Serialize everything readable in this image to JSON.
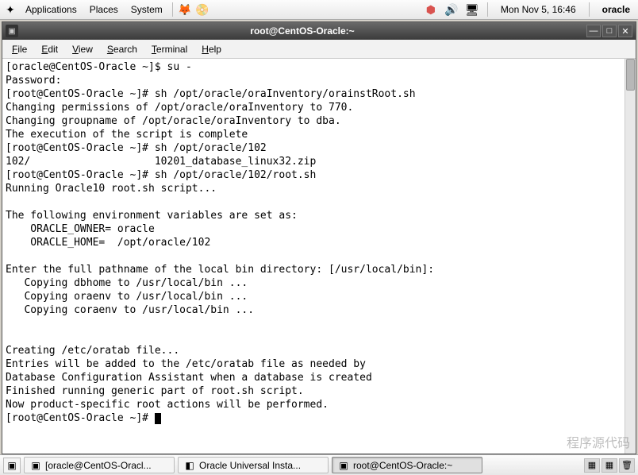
{
  "panel": {
    "applications": "Applications",
    "places": "Places",
    "system": "System",
    "clock": "Mon Nov  5, 16:46",
    "user": "oracle"
  },
  "window": {
    "title": "root@CentOS-Oracle:~"
  },
  "menus": {
    "file": "File",
    "edit": "Edit",
    "view": "View",
    "search": "Search",
    "terminal": "Terminal",
    "help": "Help"
  },
  "terminal": {
    "lines": [
      "[oracle@CentOS-Oracle ~]$ su -",
      "Password:",
      "[root@CentOS-Oracle ~]# sh /opt/oracle/oraInventory/orainstRoot.sh",
      "Changing permissions of /opt/oracle/oraInventory to 770.",
      "Changing groupname of /opt/oracle/oraInventory to dba.",
      "The execution of the script is complete",
      "[root@CentOS-Oracle ~]# sh /opt/oracle/102",
      "102/                    10201_database_linux32.zip",
      "[root@CentOS-Oracle ~]# sh /opt/oracle/102/root.sh",
      "Running Oracle10 root.sh script...",
      "",
      "The following environment variables are set as:",
      "    ORACLE_OWNER= oracle",
      "    ORACLE_HOME=  /opt/oracle/102",
      "",
      "Enter the full pathname of the local bin directory: [/usr/local/bin]:",
      "   Copying dbhome to /usr/local/bin ...",
      "   Copying oraenv to /usr/local/bin ...",
      "   Copying coraenv to /usr/local/bin ...",
      "",
      "",
      "Creating /etc/oratab file...",
      "Entries will be added to the /etc/oratab file as needed by",
      "Database Configuration Assistant when a database is created",
      "Finished running generic part of root.sh script.",
      "Now product-specific root actions will be performed.",
      "[root@CentOS-Oracle ~]# "
    ]
  },
  "taskbar": {
    "task1": "[oracle@CentOS-Oracl...",
    "task2": "Oracle Universal Insta...",
    "task3": "root@CentOS-Oracle:~"
  },
  "watermark": "程序源代码"
}
